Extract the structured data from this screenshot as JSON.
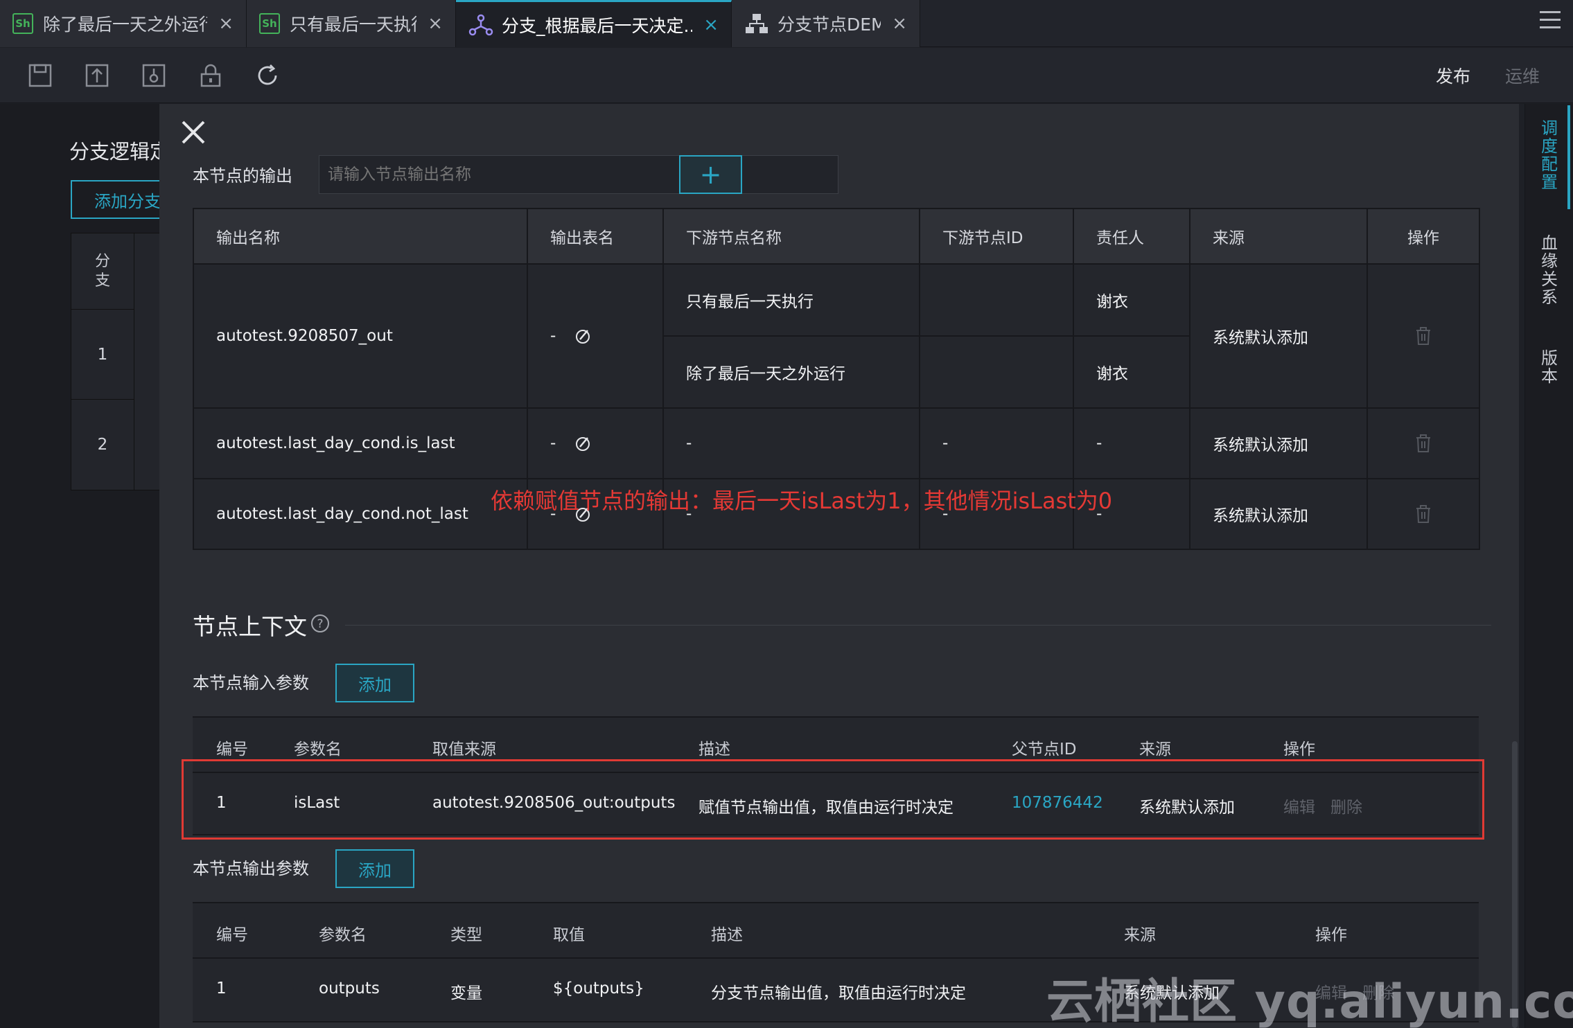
{
  "tabs": [
    {
      "label": "除了最后一天之外运行",
      "icon": "shell-icon",
      "icon_text": "Sh",
      "close": "×"
    },
    {
      "label": "只有最后一天执行",
      "icon": "shell-icon",
      "icon_text": "Sh",
      "close": "×"
    },
    {
      "label": "分支_根据最后一天决定...",
      "icon": "branch-node-icon",
      "close": "×",
      "active": true
    },
    {
      "label": "分支节点DEMO",
      "icon": "workflow-icon",
      "close": "×"
    }
  ],
  "toolbar": {
    "icons": [
      "save-icon",
      "submit-icon",
      "steal-lock-icon",
      "lock-icon",
      "refresh-icon"
    ],
    "publish": "发布",
    "ops": "运维"
  },
  "background_panel": {
    "title": "分支逻辑定",
    "add_button": "添加分支",
    "col_header": "分支",
    "rows": [
      "1",
      "2"
    ]
  },
  "side_rail": {
    "schedule": "调度配置",
    "lineage": "血缘关系",
    "version": "版本"
  },
  "node_output": {
    "label": "本节点的输出",
    "input_placeholder": "请输入节点输出名称",
    "add_button": "+",
    "headers": [
      "输出名称",
      "输出表名",
      "下游节点名称",
      "下游节点ID",
      "责任人",
      "来源",
      "操作"
    ],
    "rows": [
      {
        "name": "autotest.9208507_out",
        "table": "-",
        "downstream": [
          {
            "name": "只有最后一天执行",
            "id": "",
            "owner": "谢衣"
          },
          {
            "name": "除了最后一天之外运行",
            "id": "",
            "owner": "谢衣"
          }
        ],
        "source": "系统默认添加"
      },
      {
        "name": "autotest.last_day_cond.is_last",
        "table": "-",
        "downstream_name": "-",
        "downstream_id": "-",
        "owner": "-",
        "source": "系统默认添加"
      },
      {
        "name": "autotest.last_day_cond.not_last",
        "table": "-",
        "downstream_name": "-",
        "downstream_id": "-",
        "owner": "-",
        "source": "系统默认添加"
      }
    ]
  },
  "context": {
    "title": "节点上下文",
    "input_label": "本节点输入参数",
    "input_add": "添加",
    "input_headers": [
      "编号",
      "参数名",
      "取值来源",
      "描述",
      "父节点ID",
      "来源",
      "操作"
    ],
    "input_rows": [
      {
        "no": "1",
        "param": "isLast",
        "value_source": "autotest.9208506_out:outputs",
        "desc": "赋值节点输出值，取值由运行时决定",
        "parent_id": "107876442",
        "source": "系统默认添加",
        "edit": "编辑",
        "delete": "删除"
      }
    ],
    "output_label": "本节点输出参数",
    "output_add": "添加",
    "output_headers": [
      "编号",
      "参数名",
      "类型",
      "取值",
      "描述",
      "来源",
      "操作"
    ],
    "output_rows": [
      {
        "no": "1",
        "param": "outputs",
        "type": "变量",
        "value": "${outputs}",
        "desc": "分支节点输出值，取值由运行时决定",
        "source": "系统默认添加",
        "edit": "编辑",
        "delete": "删除"
      }
    ]
  },
  "annotation": "依赖赋值节点的输出：最后一天isLast为1，其他情况isLast为0",
  "watermark": "云栖社区 yq.aliyun.com",
  "colors": {
    "accent": "#2aa6c4",
    "annotation": "#e53935",
    "shell_badge": "#44b35a"
  }
}
